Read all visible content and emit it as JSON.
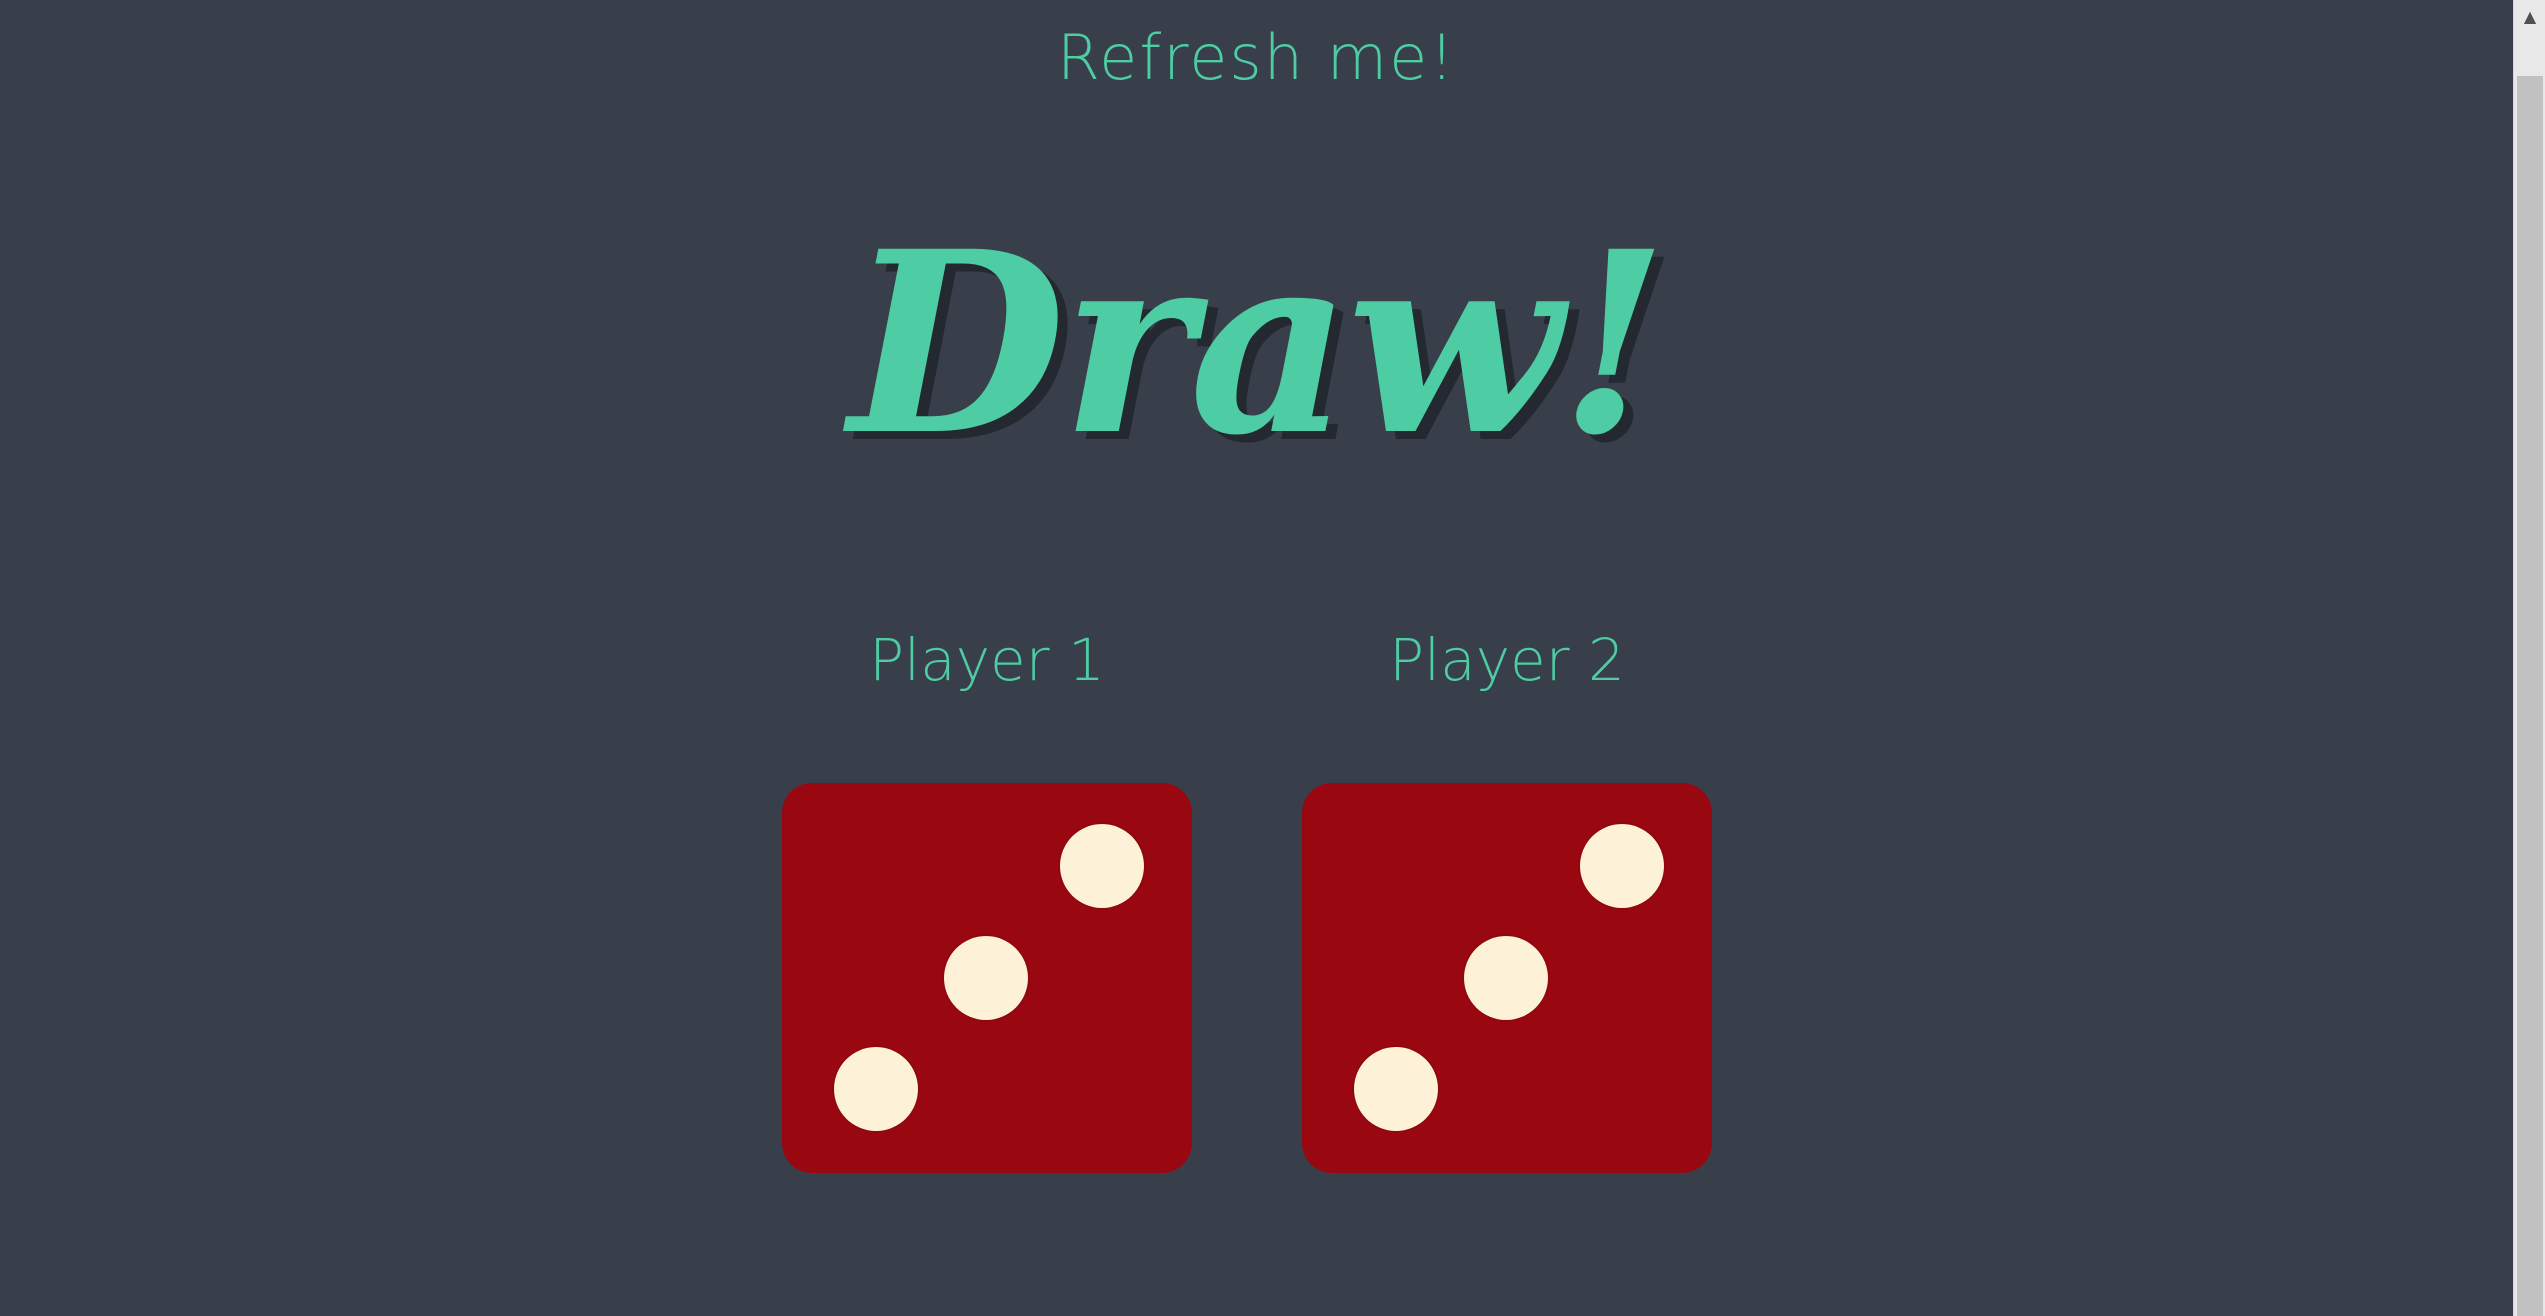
{
  "header": {
    "refresh_label": "Refresh me!"
  },
  "result": {
    "headline": "Draw!"
  },
  "players": [
    {
      "label": "Player 1",
      "die_value": 3,
      "die_color": "#990710"
    },
    {
      "label": "Player 2",
      "die_value": 3,
      "die_color": "#990710"
    }
  ],
  "colors": {
    "background": "#393f4a",
    "accent": "#4ecca3",
    "pip": "#fdf2d7",
    "shadow": "#232831"
  },
  "scrollbar": {
    "up_arrow_icon": "triangle-up-icon",
    "up_arrow_glyph": "▲"
  }
}
